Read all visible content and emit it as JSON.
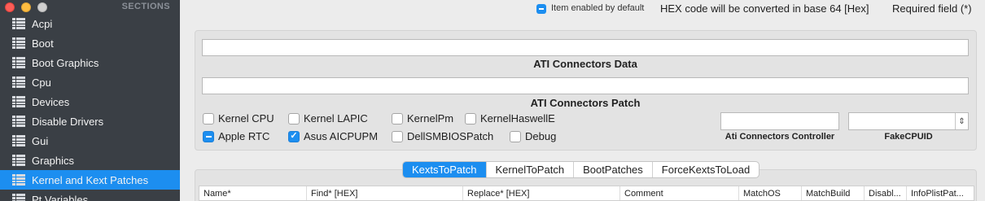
{
  "sidebar": {
    "header": "SECTIONS",
    "items": [
      {
        "label": "Acpi"
      },
      {
        "label": "Boot"
      },
      {
        "label": "Boot Graphics"
      },
      {
        "label": "Cpu"
      },
      {
        "label": "Devices"
      },
      {
        "label": "Disable Drivers"
      },
      {
        "label": "Gui"
      },
      {
        "label": "Graphics"
      },
      {
        "label": "Kernel and Kext Patches",
        "selected": true
      },
      {
        "label": "Pt Variables"
      }
    ]
  },
  "legend": {
    "item_enabled": "Item enabled by default",
    "hex_note": "HEX code will be converted in base 64 [Hex]",
    "required": "Required field (*)"
  },
  "fields": {
    "ati_connectors_data": {
      "label": "ATI Connectors Data",
      "value": ""
    },
    "ati_connectors_patch": {
      "label": "ATI Connectors Patch",
      "value": ""
    },
    "ati_connectors_controller": {
      "label": "Ati Connectors Controller",
      "value": ""
    },
    "fake_cpuid": {
      "label": "FakeCPUID",
      "value": ""
    }
  },
  "checkboxes": {
    "kernel_cpu": {
      "label": "Kernel CPU",
      "state": "unchecked"
    },
    "kernel_lapic": {
      "label": "Kernel LAPIC",
      "state": "unchecked"
    },
    "kernel_pm": {
      "label": "KernelPm",
      "state": "unchecked"
    },
    "kernel_haswelle": {
      "label": "KernelHaswellE",
      "state": "unchecked"
    },
    "apple_rtc": {
      "label": "Apple RTC",
      "state": "mixed"
    },
    "asus_aicpupm": {
      "label": "Asus AICPUPM",
      "state": "checked"
    },
    "dell_smbios_patch": {
      "label": "DellSMBIOSPatch",
      "state": "unchecked"
    },
    "debug": {
      "label": "Debug",
      "state": "unchecked"
    }
  },
  "tabs": [
    {
      "label": "KextsToPatch",
      "active": true
    },
    {
      "label": "KernelToPatch"
    },
    {
      "label": "BootPatches"
    },
    {
      "label": "ForceKextsToLoad"
    }
  ],
  "table": {
    "columns": [
      "Name*",
      "Find* [HEX]",
      "Replace* [HEX]",
      "Comment",
      "MatchOS",
      "MatchBuild",
      "Disabl...",
      "InfoPlistPat..."
    ]
  },
  "colors": {
    "accent": "#1c8ef0",
    "sidebar_bg": "#3a3f45"
  }
}
